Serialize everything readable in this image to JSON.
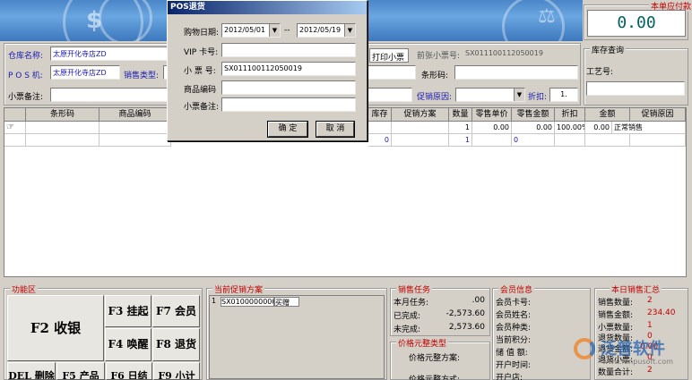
{
  "header": {
    "amount_due_label": "本单应付款",
    "amount_due_value": "0.00"
  },
  "inventory_query": {
    "title": "库存查询",
    "craft_no_label": "工艺号:"
  },
  "form": {
    "warehouse_label": "仓库名称:",
    "warehouse_value": "太原开化寺店ZD",
    "pos_label": "P O S 机:",
    "pos_value": "太原开化寺店ZD",
    "sale_type_label": "销售类型:",
    "receipt_note_label": "小票备注:",
    "print_receipt_label": "打印小票",
    "prev_receipt_label": "前张小票号:",
    "prev_receipt_value": "SX011100112050019",
    "barcode_label": "条形码:",
    "promo_reason_label": "促销原因:",
    "discount_label": "折扣:",
    "discount_value": "1."
  },
  "dialog": {
    "title": "POS退货",
    "date_label": "购物日期:",
    "date_from": "2012/05/01",
    "date_sep": "--",
    "date_to": "2012/05/19",
    "vip_label": "VIP 卡号:",
    "receipt_no_label": "小 票 号:",
    "receipt_no_value": "SX011100112050019",
    "product_code_label": "商品编码",
    "receipt_note_label": "小票备注:",
    "ok_label": "确 定",
    "cancel_label": "取 消"
  },
  "grid": {
    "columns": [
      "条形码",
      "商品编码",
      "库存",
      "促销方案",
      "数量",
      "零售单价",
      "零售金额",
      "折扣",
      "金额",
      "促销原因"
    ],
    "row1": {
      "qty": "1",
      "unit_price": "0.00",
      "retail_amount": "0.00",
      "discount": "100.00%",
      "amount": "0.00",
      "reason": "正常销售"
    },
    "row2": {
      "stock": "0",
      "qty": "1",
      "retail_amount": "0"
    }
  },
  "function_area": {
    "title": "功能区",
    "checkout": "F2 收银",
    "hold": "F3 挂起",
    "member": "F7 会员",
    "wake": "F4 唤醒",
    "return": "F8 退货",
    "del": "DEL 删除",
    "f5": "F5 产品",
    "f6": "F6 日结",
    "f9": "F9 小计"
  },
  "promo": {
    "title": "当前促销方案",
    "row_index": "1",
    "row_code": "SX0100000000",
    "row_name": "买赠"
  },
  "sales_task": {
    "title": "销售任务",
    "month_task_label": "本月任务:",
    "month_task_value": ".00",
    "completed_label": "已完成:",
    "completed_value": "-2,573.60",
    "incomplete_label": "未完成:",
    "incomplete_value": "2,573.60"
  },
  "price_type": {
    "title": "价格元整类型",
    "plan_label": "价格元整方案:",
    "form_label": "价格元整方式:"
  },
  "member_info": {
    "title": "会员信息",
    "card_label": "会员卡号:",
    "name_label": "会员姓名:",
    "type_label": "会员种类:",
    "points_label": "当前积分:",
    "balance_label": "储 值 额:",
    "open_time_label": "开户时间:",
    "open_store_label": "开户店:"
  },
  "daily_summary": {
    "title": "本日销售汇总",
    "qty_label": "销售数量:",
    "qty_value": "2",
    "amount_label": "销售金额:",
    "amount_value": "234.40",
    "receipts_label": "小票数量:",
    "receipts_value": "1",
    "return_qty_label": "退货数量:",
    "return_qty_value": "0",
    "return_amount_label": "退货金额:",
    "return_amount_value": "0.00",
    "return_receipts_label": "退货小票:",
    "return_receipts_value": "0",
    "qty_total_label": "数量合计:",
    "qty_total_value": "2"
  },
  "watermark": {
    "text": "泛普软件",
    "url": "www.fanpusoft.com"
  }
}
